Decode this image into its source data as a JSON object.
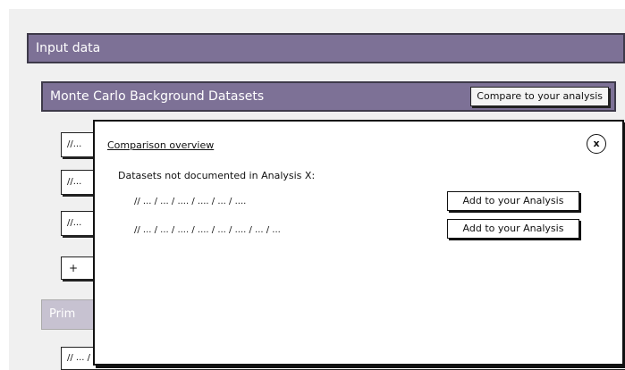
{
  "input_data": {
    "title": "Input data"
  },
  "mc_section": {
    "title": "Monte Carlo Background Datasets",
    "compare_label": "Compare to your analysis"
  },
  "background_rows": [
    "//...",
    "//...",
    "//..."
  ],
  "add_row_label": "+",
  "primary_section": {
    "title": "Prim"
  },
  "bottom_row": {
    "text": "// ... / ... / ... / ..."
  },
  "dialog": {
    "title": "Comparison overview",
    "close_label": "x",
    "subtitle": "Datasets not documented in Analysis X:",
    "datasets": [
      {
        "path": "// ... / ... / .... / .... / ... / ....",
        "button": "Add to your Analysis"
      },
      {
        "path": "// ... / ... / .... / .... / ... / .... / ... / ...",
        "button": "Add to your Analysis"
      }
    ]
  },
  "colors": {
    "section_header": "#7d7196",
    "section_header_inactive": "#c7c2d1",
    "canvas_background": "#f0f0f0"
  }
}
